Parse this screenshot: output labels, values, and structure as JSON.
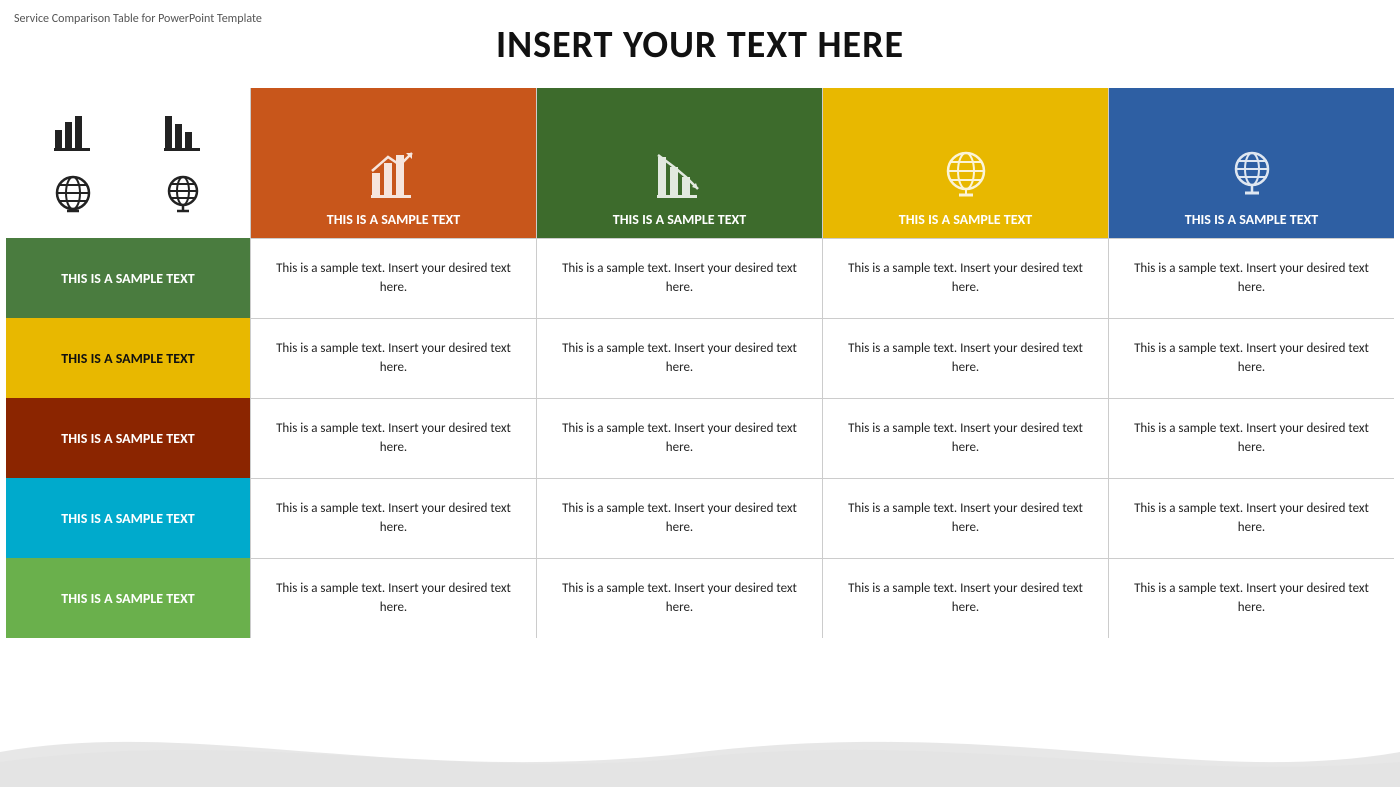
{
  "watermark": "Service Comparison Table for PowerPoint Template",
  "title": "INSERT YOUR TEXT HERE",
  "col_headers": [
    {
      "label": "THIS IS A SAMPLE TEXT",
      "color_class": "col-header-orange"
    },
    {
      "label": "THIS IS A SAMPLE TEXT",
      "color_class": "col-header-dkgreen"
    },
    {
      "label": "THIS IS A SAMPLE TEXT",
      "color_class": "col-header-yellow2"
    },
    {
      "label": "THIS IS A SAMPLE TEXT",
      "color_class": "col-header-blue"
    }
  ],
  "rows": [
    {
      "label": "THIS IS A SAMPLE TEXT",
      "label_class": "row-label-green",
      "cells": [
        "This is a sample text. Insert your desired text here.",
        "This is a sample text. Insert your desired text here.",
        "This is a sample text. Insert your desired text here.",
        "This is a sample text. Insert your desired text here."
      ]
    },
    {
      "label": "THIS IS A SAMPLE TEXT",
      "label_class": "row-label-yellow",
      "cells": [
        "This is a sample text. Insert your desired text here.",
        "This is a sample text. Insert your desired text here.",
        "This is a sample text. Insert your desired text here.",
        "This is a sample text. Insert your desired text here."
      ]
    },
    {
      "label": "THIS IS A SAMPLE TEXT",
      "label_class": "row-label-brown",
      "cells": [
        "This is a sample text. Insert your desired text here.",
        "This is a sample text. Insert your desired text here.",
        "This is a sample text. Insert your desired text here.",
        "This is a sample text. Insert your desired text here."
      ]
    },
    {
      "label": "THIS IS A SAMPLE TEXT",
      "label_class": "row-label-cyan",
      "cells": [
        "This is a sample text. Insert your desired text here.",
        "This is a sample text. Insert your desired text here.",
        "This is a sample text. Insert your desired text here.",
        "This is a sample text. Insert your desired text here."
      ]
    },
    {
      "label": "THIS IS A SAMPLE TEXT",
      "label_class": "row-label-lime",
      "cells": [
        "This is a sample text. Insert your desired text here.",
        "This is a sample text. Insert your desired text here.",
        "This is a sample text. Insert your desired text here.",
        "This is a sample text. Insert your desired text here."
      ]
    }
  ]
}
